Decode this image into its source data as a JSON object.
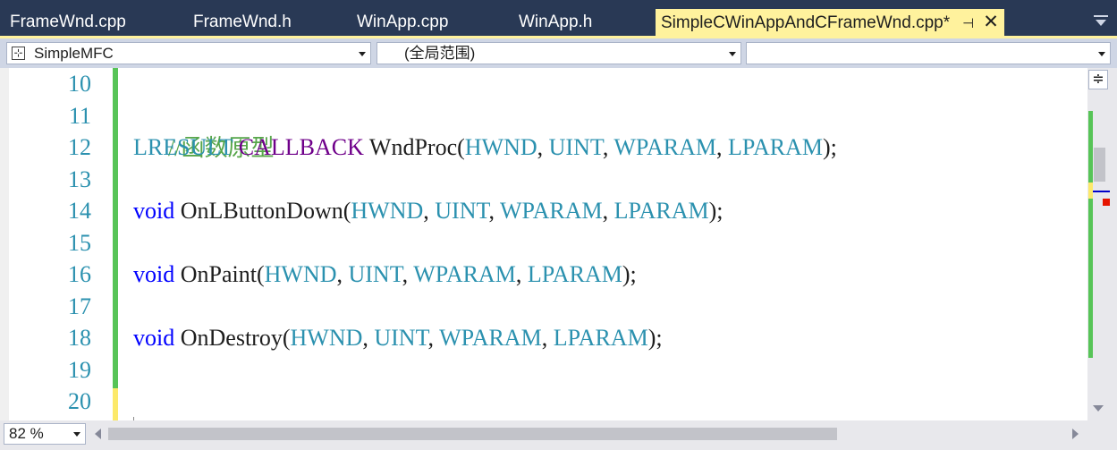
{
  "tabs": [
    {
      "label": "FrameWnd.cpp",
      "active": false
    },
    {
      "label": "FrameWnd.h",
      "active": false
    },
    {
      "label": "WinApp.cpp",
      "active": false
    },
    {
      "label": "WinApp.h",
      "active": false
    },
    {
      "label": "SimpleCWinAppAndCFrameWnd.cpp*",
      "active": true,
      "pin_glyph": "⊣",
      "close_glyph": "✕"
    }
  ],
  "navbar": {
    "project": "SimpleMFC",
    "scope": "(全局范围)",
    "member": ""
  },
  "editor": {
    "lines": [
      {
        "num": "10"
      },
      {
        "num": "11"
      },
      {
        "num": "12"
      },
      {
        "num": "13"
      },
      {
        "num": "14"
      },
      {
        "num": "15"
      },
      {
        "num": "16"
      },
      {
        "num": "17"
      },
      {
        "num": "18"
      },
      {
        "num": "19"
      },
      {
        "num": "20"
      }
    ],
    "code": {
      "l11": "//函数原型",
      "l12": {
        "t1": "LRESULT",
        "t2": " ",
        "t3": "CALLBACK",
        "t4": " WndProc(",
        "t5": "HWND",
        "t6": ", ",
        "t7": "UINT",
        "t8": ", ",
        "t9": "WPARAM",
        "t10": ", ",
        "t11": "LPARAM",
        "t12": ");"
      },
      "l14": {
        "t1": "void",
        "t2": " OnLButtonDown(",
        "t3": "HWND",
        "t4": ", ",
        "t5": "UINT",
        "t6": ", ",
        "t7": "WPARAM",
        "t8": ", ",
        "t9": "LPARAM",
        "t10": ");"
      },
      "l16": {
        "t1": "void",
        "t2": " OnPaint(",
        "t3": "HWND",
        "t4": ", ",
        "t5": "UINT",
        "t6": ", ",
        "t7": "WPARAM",
        "t8": ", ",
        "t9": "LPARAM",
        "t10": ");"
      },
      "l18": {
        "t1": "void",
        "t2": " OnDestroy(",
        "t3": "HWND",
        "t4": ", ",
        "t5": "UINT",
        "t6": ", ",
        "t7": "WPARAM",
        "t8": ", ",
        "t9": "LPARAM",
        "t10": ");"
      }
    }
  },
  "statusbar": {
    "zoom": "82 %"
  },
  "colors": {
    "tab_strip": "#293955",
    "active_tab": "#fff29d",
    "comment": "#57a64a",
    "keyword": "#0000ff",
    "type": "#2b91af",
    "macro": "#6f008a",
    "saved_change": "#57c457",
    "unsaved_change": "#fce96a"
  },
  "icons": {
    "split": "split-window-icon",
    "class": "class-icon",
    "overflow": "tab-overflow-icon"
  }
}
